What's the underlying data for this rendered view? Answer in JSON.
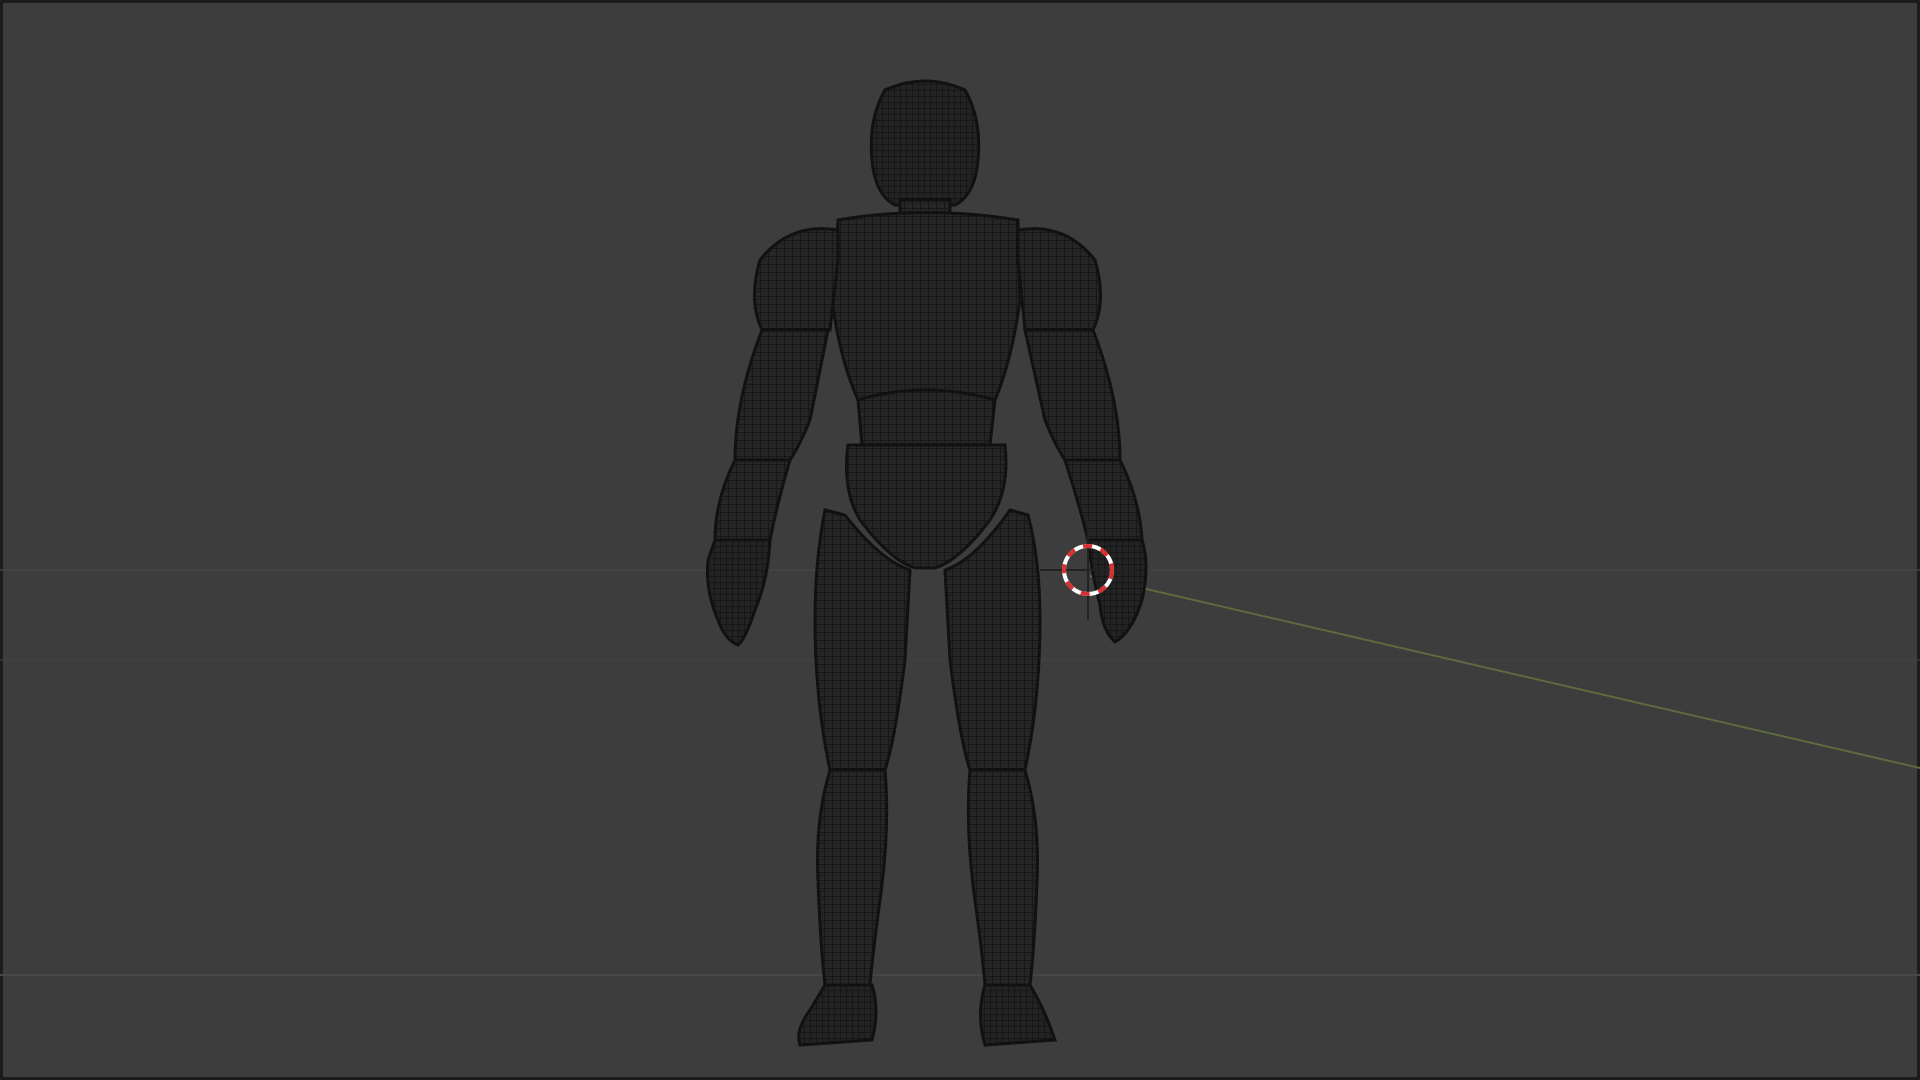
{
  "app": {
    "view_mode": "wireframe",
    "object_label": ""
  },
  "viewport": {
    "background_color": "#3d3d3d",
    "border_color": "#1c1c1c",
    "grid_color": "#454545",
    "x_axis_color": "#5d6b3f",
    "mesh_fill_color": "#252525",
    "mesh_wire_color": "#0e0e0e",
    "cursor_colors": [
      "#d63232",
      "#ffffff"
    ]
  },
  "objects": [
    {
      "name": "humanoid-figure",
      "type": "mesh",
      "display": "wireframe"
    },
    {
      "name": "3d-cursor",
      "type": "cursor"
    }
  ]
}
